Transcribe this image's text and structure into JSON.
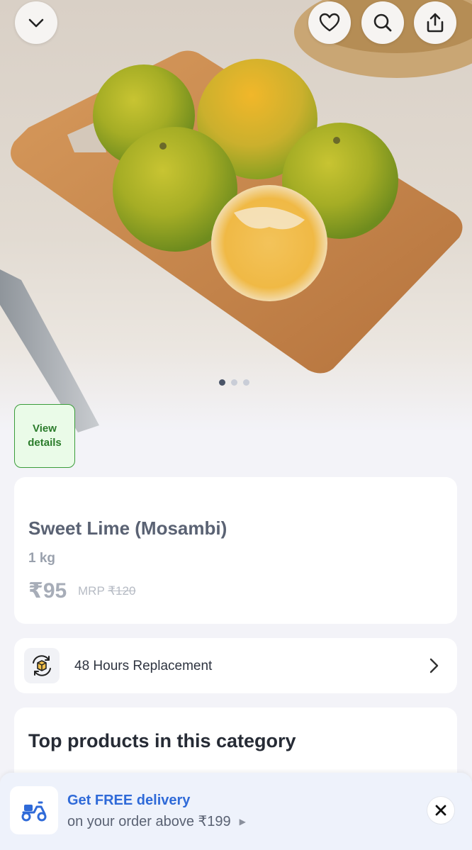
{
  "header": {
    "collapse_icon": "chevron-down-icon",
    "wishlist_icon": "heart-icon",
    "search_icon": "search-icon",
    "share_icon": "share-icon"
  },
  "gallery": {
    "image_subject": "sweet limes on wooden cutting board",
    "dot_count": 3,
    "active_index": 0
  },
  "view_details": {
    "line1": "View",
    "line2": "details"
  },
  "product": {
    "name": "Sweet Lime (Mosambi)",
    "weight": "1 kg",
    "price": "₹95",
    "mrp_label": "MRP",
    "mrp_value": "₹120"
  },
  "replacement": {
    "label": "48 Hours Replacement",
    "icon": "replacement-box-icon"
  },
  "top_products": {
    "title": "Top products in this category"
  },
  "delivery_banner": {
    "title": "Get FREE delivery",
    "subtitle": "on your order above ₹199",
    "icon": "scooter-icon"
  },
  "colors": {
    "accent_blue": "#2f6ad8",
    "view_details_green": "#2b7c2b",
    "background": "#f3f3f8"
  }
}
